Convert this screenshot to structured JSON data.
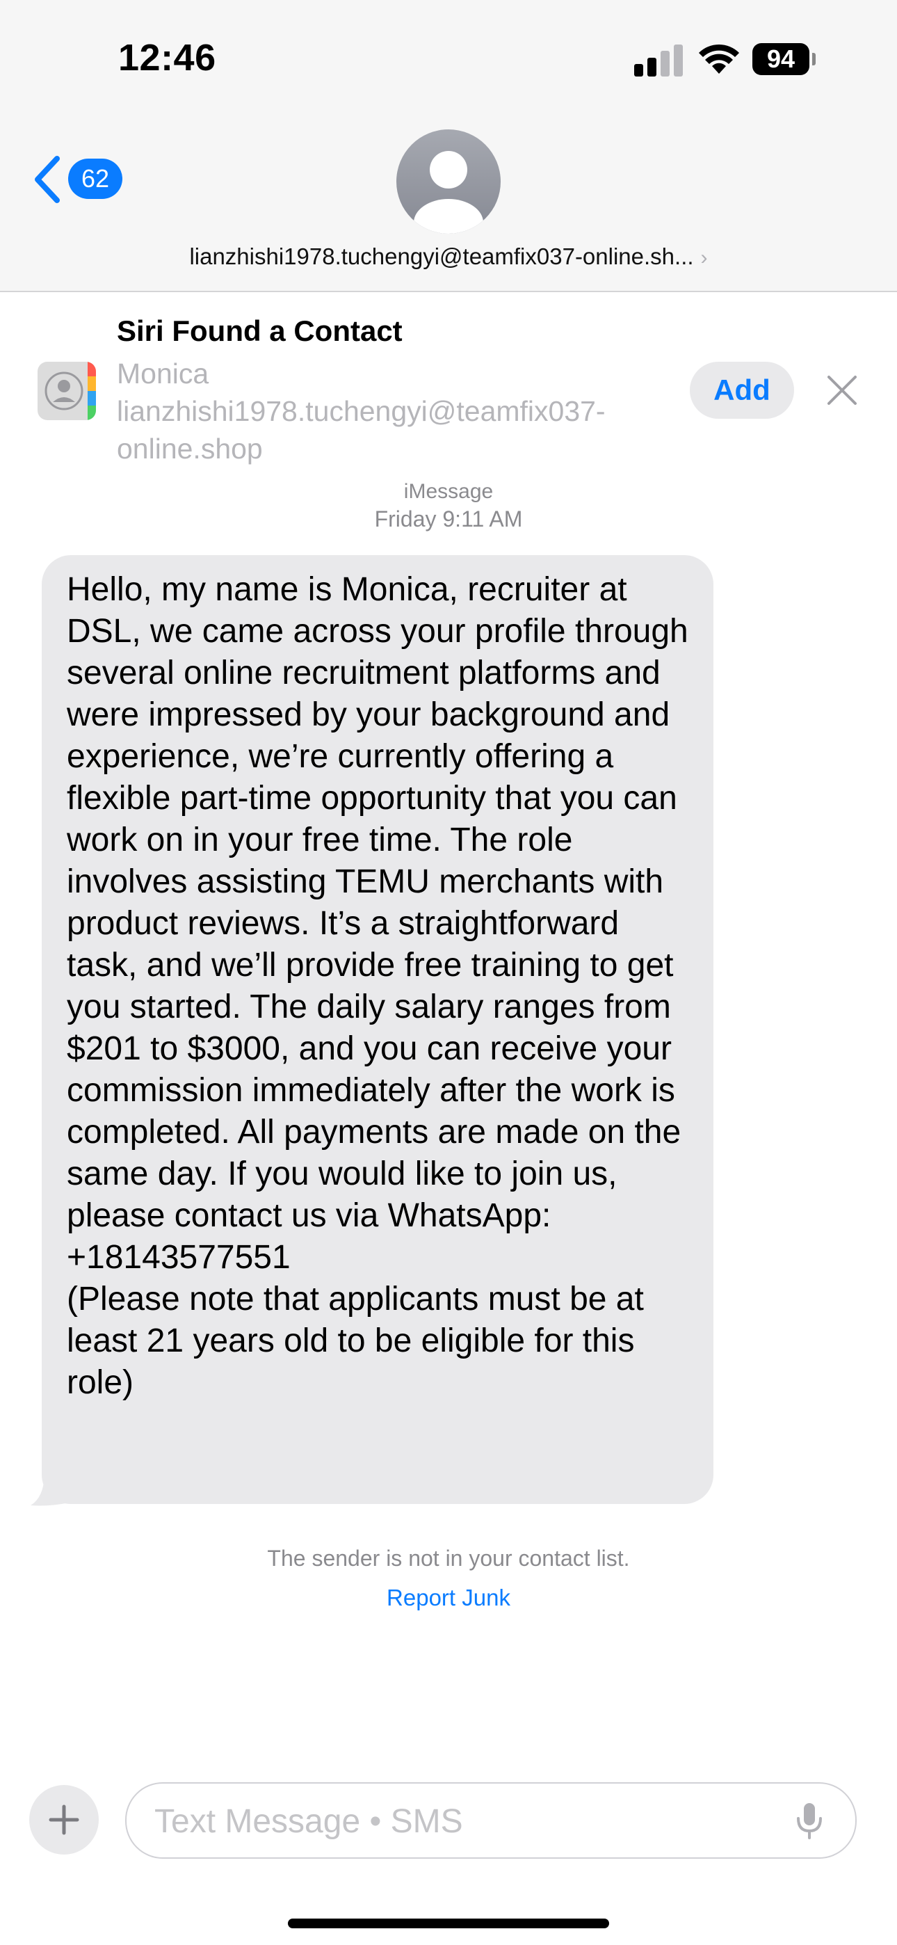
{
  "status_bar": {
    "time": "12:46",
    "battery": "94"
  },
  "header": {
    "back_badge": "62",
    "contact_address": "lianzhishi1978.tuchengyi@teamfix037-online.sh...",
    "chevron": "›"
  },
  "siri_suggestion": {
    "title": "Siri Found a Contact",
    "name": "Monica",
    "email_line1": "lianzhishi1978.tuchengyi@teamfix037-",
    "email_line2": "online.shop",
    "add_label": "Add"
  },
  "message": {
    "service": "iMessage",
    "timestamp": "Friday 9:11 AM",
    "body": "Hello, my name is Monica, recruiter at DSL, we came across your profile through several online recruitment platforms and were impressed by your background and experience, we’re currently offering a flexible part-time opportunity that you can work on in your free time. The role involves assisting TEMU merchants with product reviews. It’s a straightforward task, and we’ll provide free training to get you started. The daily salary ranges from $201 to $3000, and you can receive your commission immediately after the work is completed. All payments are made on the same day. If you would like to join us, please contact us via WhatsApp: +18143577551\n(Please note that applicants must be at least 21 years old to be eligible for this role)"
  },
  "footer_notice": {
    "text": "The sender is not in your contact list.",
    "report_link": "Report Junk"
  },
  "composer": {
    "placeholder": "Text Message • SMS"
  },
  "colors": {
    "accent": "#0a7cff",
    "bubble": "#e9e9eb",
    "secondary_text": "#8a8a8e"
  },
  "icons": {
    "back": "chevron-left-icon",
    "avatar": "person-icon",
    "close": "close-icon",
    "plus": "plus-icon",
    "mic": "microphone-icon",
    "signal": "cellular-signal-icon",
    "wifi": "wifi-icon"
  }
}
